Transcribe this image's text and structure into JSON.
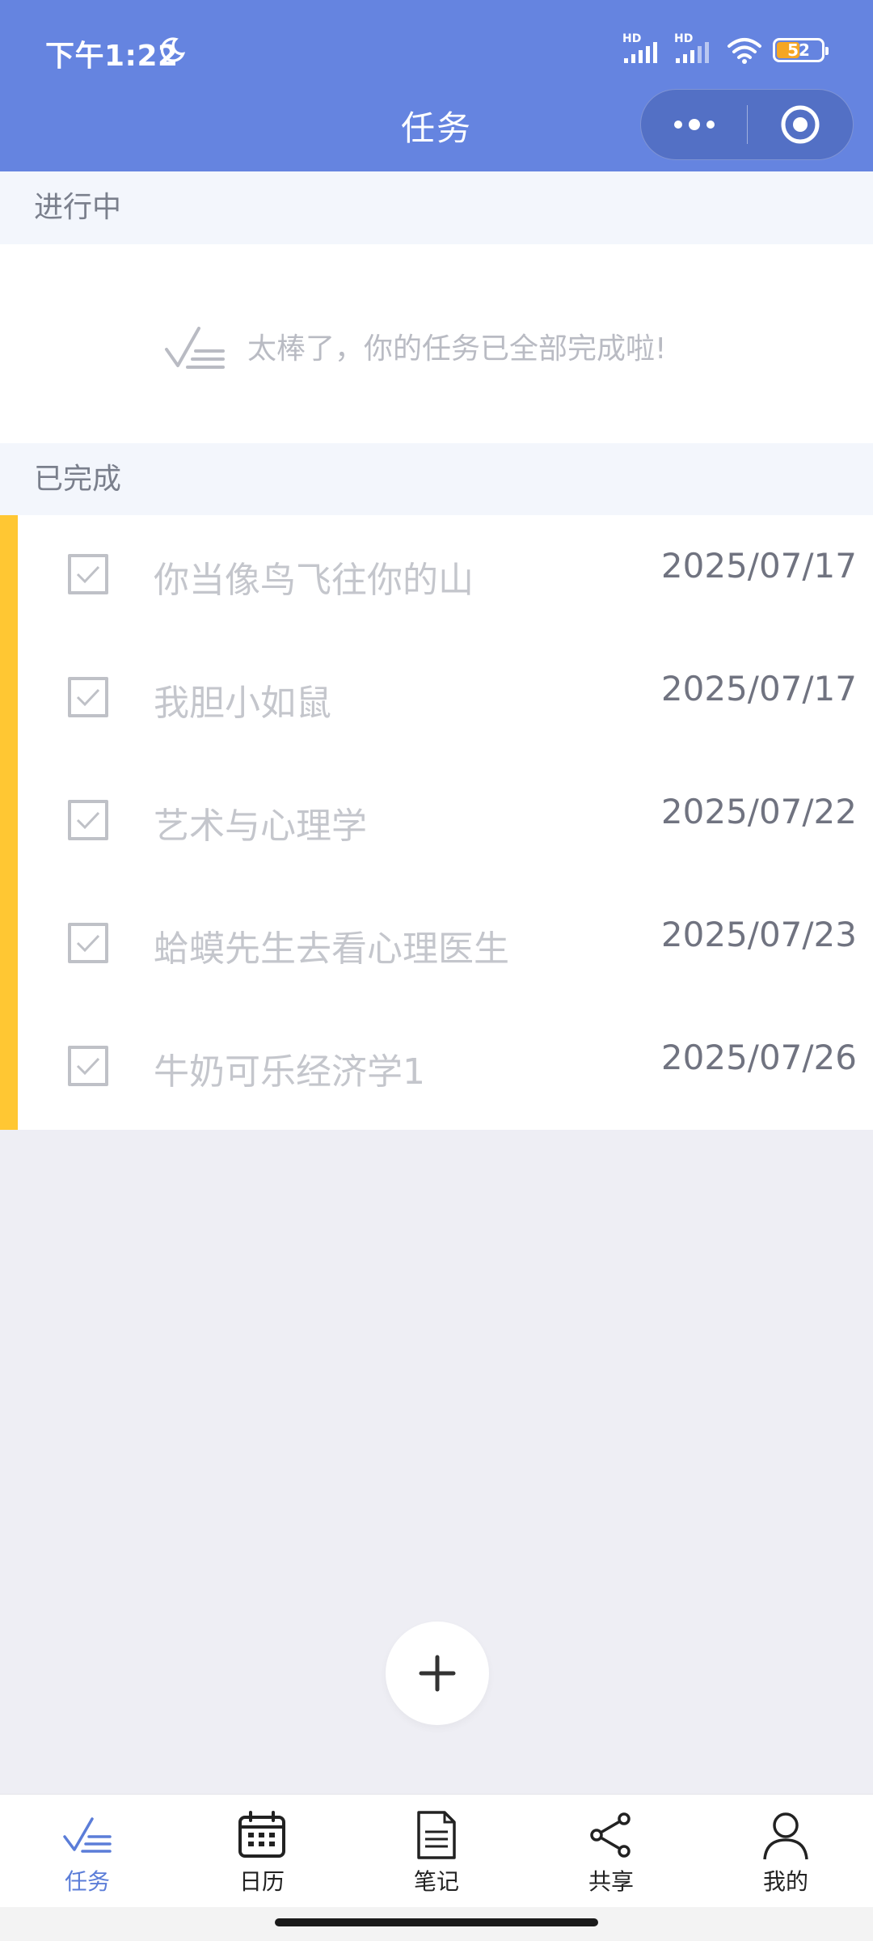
{
  "status_bar": {
    "time": "下午1:22",
    "signal_label_1": "HD",
    "signal_label_2": "HD",
    "battery_level": "52",
    "battery_fraction": 0.52
  },
  "nav": {
    "title": "任务",
    "more_icon": "more-dots-icon",
    "close_icon": "target-circle-icon"
  },
  "in_progress": {
    "header": "进行中",
    "empty_message": "太棒了，你的任务已全部完成啦!"
  },
  "completed": {
    "header": "已完成",
    "accent_color": "#FFC733",
    "items": [
      {
        "title": "你当像鸟飞往你的山",
        "date": "2025/07/17"
      },
      {
        "title": "我胆小如鼠",
        "date": "2025/07/17"
      },
      {
        "title": "艺术与心理学",
        "date": "2025/07/22"
      },
      {
        "title": "蛤蟆先生去看心理医生",
        "date": "2025/07/23"
      },
      {
        "title": "牛奶可乐经济学1",
        "date": "2025/07/26"
      }
    ]
  },
  "fab": {
    "icon": "plus-icon"
  },
  "tabbar": {
    "accent_color": "#5B7DD8",
    "tabs": [
      {
        "label": "任务",
        "icon": "task-check-icon",
        "active": true
      },
      {
        "label": "日历",
        "icon": "calendar-icon",
        "active": false
      },
      {
        "label": "笔记",
        "icon": "note-document-icon",
        "active": false
      },
      {
        "label": "共享",
        "icon": "share-icon",
        "active": false
      },
      {
        "label": "我的",
        "icon": "user-icon",
        "active": false
      }
    ]
  },
  "colors": {
    "header_bg": "#6584E0",
    "section_bg": "#F3F6FC",
    "page_bg": "#EEEEF4"
  }
}
